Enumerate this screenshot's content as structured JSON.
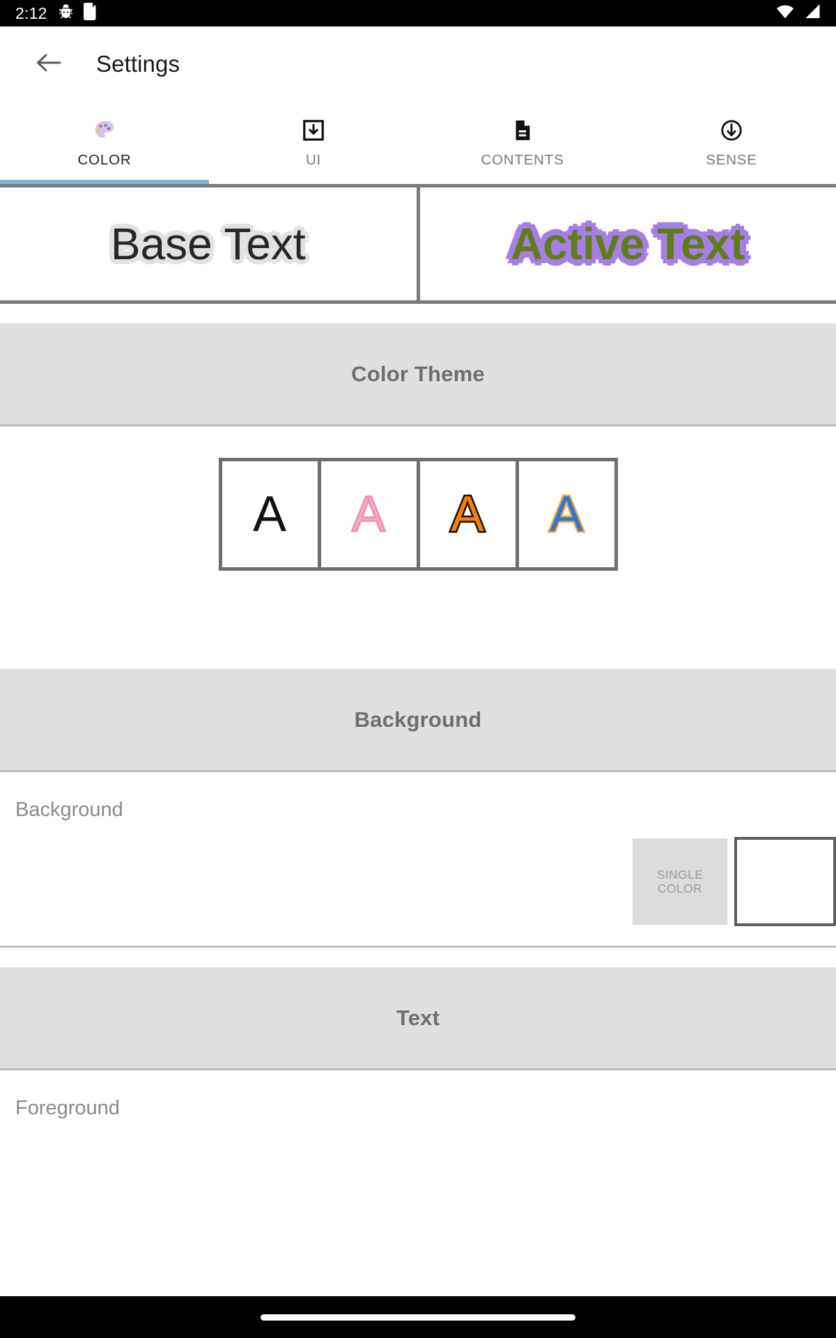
{
  "status_bar": {
    "time": "2:12",
    "icons": [
      "android-debug-icon",
      "sd-card-icon",
      "wifi-icon",
      "signal-icon"
    ]
  },
  "app_bar": {
    "back_icon": "back-arrow-icon",
    "title": "Settings"
  },
  "tabs": {
    "active_index": 0,
    "indicator_color": "#7fb2dd",
    "items": [
      {
        "label": "COLOR",
        "icon": "palette-icon",
        "active": true
      },
      {
        "label": "UI",
        "icon": "download-box-icon",
        "active": false
      },
      {
        "label": "CONTENTS",
        "icon": "document-icon",
        "active": false
      },
      {
        "label": "SENSE",
        "icon": "circle-arrow-down-icon",
        "active": false
      }
    ]
  },
  "preview": {
    "base": {
      "text": "Base Text",
      "text_color": "#262626",
      "outline_color": "#e2e2e2"
    },
    "active": {
      "text": "Active Text",
      "text_color": "#5f7d17",
      "outline_color": "#a77ee8"
    },
    "border_color": "#7b7b7b"
  },
  "sections": {
    "color_theme": {
      "title": "Color Theme",
      "swatches": [
        {
          "letter": "A",
          "fill": "#111111",
          "stroke": "#111111",
          "name": "theme-black"
        },
        {
          "letter": "A",
          "fill": "#f2a0bd",
          "stroke": "#f2a0bd",
          "name": "theme-pink"
        },
        {
          "letter": "A",
          "fill": "#f57c00",
          "stroke": "#111111",
          "name": "theme-orange-black"
        },
        {
          "letter": "A",
          "fill": "#2c78d8",
          "stroke": "#f2a93b",
          "name": "theme-blue-orange"
        }
      ]
    },
    "background": {
      "title": "Background",
      "row_label": "Background",
      "mode_button": "SINGLE COLOR",
      "swatch_color": "#ffffff"
    },
    "text": {
      "title": "Text",
      "row_label": "Foreground"
    }
  },
  "nav_bar": {
    "gesture_pill": "home-gesture-pill"
  }
}
